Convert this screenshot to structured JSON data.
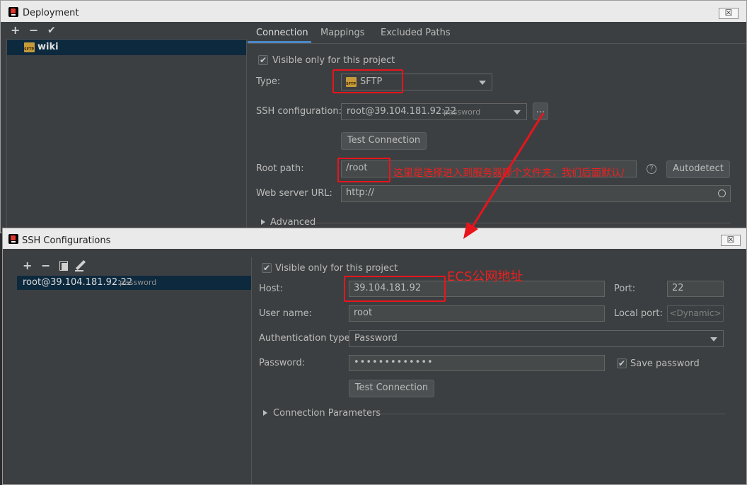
{
  "deployment": {
    "title": "Deployment",
    "close_label": "☒",
    "toolbar": {
      "add": "+",
      "remove": "−",
      "apply": "✔"
    },
    "server_list": [
      {
        "name": "wiki",
        "icon": "sftp-server-icon"
      }
    ],
    "tabs": [
      {
        "label": "Connection"
      },
      {
        "label": "Mappings"
      },
      {
        "label": "Excluded Paths"
      }
    ],
    "visible_only_label": "Visible only for this project",
    "type_label": "Type:",
    "type_value": "SFTP",
    "ssh_config_label": "SSH configuration:",
    "ssh_config_value": "root@39.104.181.92:22",
    "ssh_config_auth": "password",
    "ellipsis_label": "...",
    "test_connection_label": "Test Connection",
    "root_path_label": "Root path:",
    "root_path_value": "/root",
    "autodetect_label": "Autodetect",
    "web_server_label": "Web server URL:",
    "web_server_value": "http://",
    "advanced_label": "Advanced"
  },
  "ssh_configurations": {
    "title": "SSH Configurations",
    "close_label": "☒",
    "toolbar": {
      "add": "+",
      "remove": "−",
      "copy": "copy-icon",
      "edit": "edit-icon"
    },
    "list": [
      {
        "name": "root@39.104.181.92:22",
        "auth": "password"
      }
    ],
    "visible_only_label": "Visible only for this project",
    "host_label": "Host:",
    "host_value": "39.104.181.92",
    "port_label": "Port:",
    "port_value": "22",
    "username_label": "User name:",
    "username_value": "root",
    "local_port_label": "Local port:",
    "local_port_value": "<Dynamic>",
    "auth_type_label": "Authentication type:",
    "auth_type_value": "Password",
    "password_label": "Password:",
    "password_value": "•••••••••••••",
    "save_password_label": "Save password",
    "test_connection_label": "Test Connection",
    "connection_params_label": "Connection Parameters"
  },
  "annotations": {
    "root_path_note": "这里是选择进入到服务器哪个文件夹，我们后面默认/",
    "host_note": "ECS公网地址"
  },
  "colors": {
    "annotation_red": "#e8141c",
    "accent_blue": "#4a88c7",
    "selection": "#0d293e",
    "panel": "#3c3f41"
  }
}
